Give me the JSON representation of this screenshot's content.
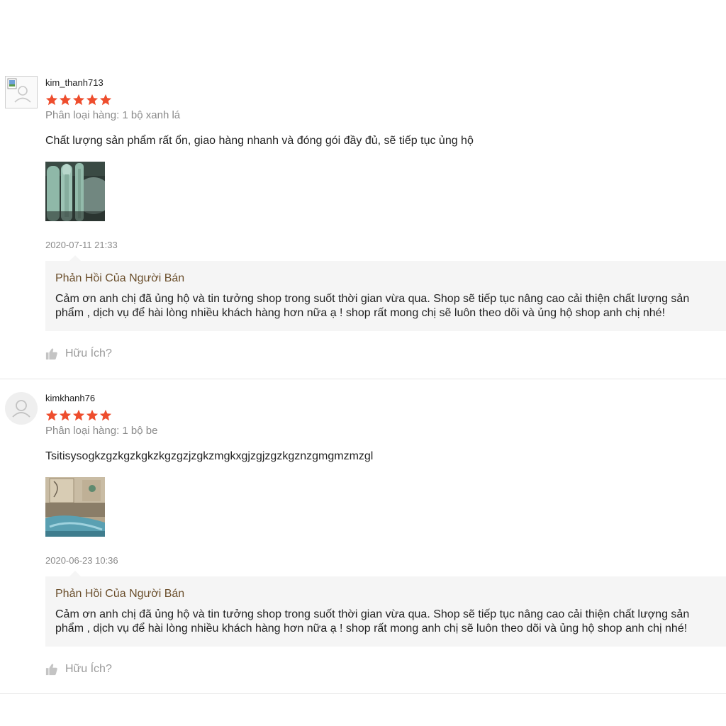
{
  "reviews": [
    {
      "username": "kim_thanh713",
      "rating": 5,
      "variation": "Phân loại hàng: 1 bộ xanh lá",
      "comment": "Chất lượng sản phẩm rất ổn, giao hàng nhanh và đóng gói đầy đủ, sẽ tiếp tục ủng hộ",
      "timestamp": "2020-07-11 21:33",
      "reply_title": "Phản Hồi Của Người Bán",
      "reply_line1": "Cảm ơn anh chị đã ủng hộ và tin tưởng shop trong suốt thời gian vừa qua. Shop sẽ tiếp tục nâng cao cải thiện chất lượng sản",
      "reply_line2": "phẩm , dịch vụ để hài lòng nhiều khách hàng hơn nữa ạ ! shop  rất mong chị sẽ luôn theo dõi và ủng hộ shop anh chị nhé!",
      "helpful_label": "Hữu Ích?"
    },
    {
      "username": "kimkhanh76",
      "rating": 5,
      "variation": "Phân loại hàng: 1 bộ be",
      "comment": "Tsitisysogkzgzkgzkgkzkgzgzjzgkzmgkxgjzgjzgzkgznzgmgmzmzgl",
      "timestamp": "2020-06-23 10:36",
      "reply_title": "Phản Hồi Của Người Bán",
      "reply_line1": "Cảm ơn anh chị đã ủng hộ và tin tưởng shop trong suốt thời gian vừa qua. Shop sẽ tiếp tục nâng cao cải thiện chất lượng sản",
      "reply_line2": "phẩm , dịch vụ để hài lòng nhiều khách hàng hơn nữa ạ ! shop  rất mong anh chị sẽ luôn theo dõi và ủng hộ shop anh chị nhé!",
      "helpful_label": "Hữu Ích?"
    }
  ],
  "icons": {
    "star": "star-icon",
    "helpful": "thumbs-up-icon",
    "avatar": "user-avatar-icon"
  },
  "colors": {
    "star": "#ee4d2d",
    "reply_title": "#6b4f2c",
    "reply_background": "#f5f5f5",
    "muted_text": "#8a8a8a"
  }
}
